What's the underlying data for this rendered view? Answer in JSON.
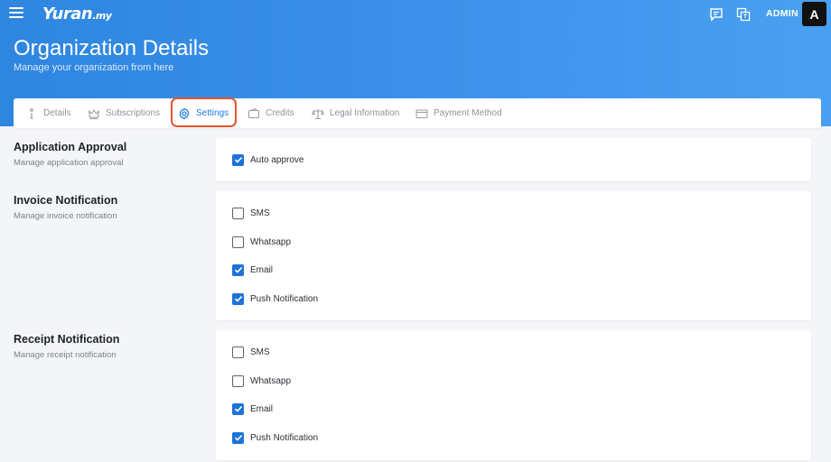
{
  "app": {
    "logo_main": "Yuran",
    "logo_suffix": ".my",
    "user_label": "ADMIN",
    "avatar_letter": "A"
  },
  "header": {
    "title": "Organization Details",
    "subtitle": "Manage your organization from here"
  },
  "tabs": [
    {
      "label": "Details",
      "icon": "info-icon",
      "active": false
    },
    {
      "label": "Subscriptions",
      "icon": "crown-icon",
      "active": false
    },
    {
      "label": "Settings",
      "icon": "gear-icon",
      "active": true
    },
    {
      "label": "Credits",
      "icon": "wallet-icon",
      "active": false
    },
    {
      "label": "Legal Information",
      "icon": "scale-icon",
      "active": false
    },
    {
      "label": "Payment Method",
      "icon": "credit-card-icon",
      "active": false
    }
  ],
  "sections": {
    "application_approval": {
      "title": "Application Approval",
      "description": "Manage application approval",
      "options": [
        {
          "label": "Auto approve",
          "checked": true
        }
      ]
    },
    "invoice_notification": {
      "title": "Invoice Notification",
      "description": "Manage invoice notification",
      "options": [
        {
          "label": "SMS",
          "checked": false
        },
        {
          "label": "Whatsapp",
          "checked": false
        },
        {
          "label": "Email",
          "checked": true
        },
        {
          "label": "Push Notification",
          "checked": true
        }
      ]
    },
    "receipt_notification": {
      "title": "Receipt Notification",
      "description": "Manage receipt notification",
      "options": [
        {
          "label": "SMS",
          "checked": false
        },
        {
          "label": "Whatsapp",
          "checked": false
        },
        {
          "label": "Email",
          "checked": true
        },
        {
          "label": "Push Notification",
          "checked": true
        }
      ]
    }
  },
  "colors": {
    "header_gradient_start": "#2e86e0",
    "accent": "#1e7ce6",
    "checkbox_checked": "#1e73d8",
    "tab_highlight": "#e4532c"
  }
}
